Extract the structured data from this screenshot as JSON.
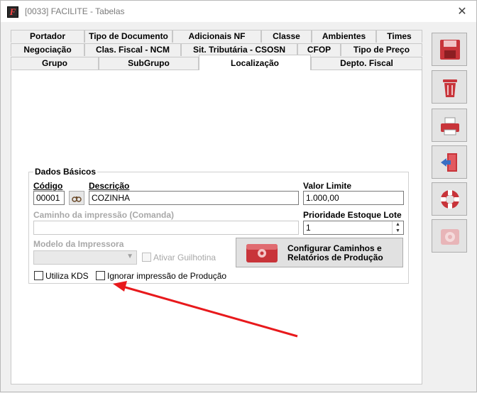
{
  "window": {
    "title": "[0033] FACILITE - Tabelas",
    "app_icon_glyph": "F",
    "close_glyph": "✕"
  },
  "tabs": {
    "row1": [
      "Portador",
      "Tipo de Documento",
      "Adicionais NF",
      "Classe",
      "Ambientes",
      "Times"
    ],
    "row2": [
      "Negociação",
      "Clas. Fiscal - NCM",
      "Sit. Tributária - CSOSN",
      "CFOP",
      "Tipo de Preço"
    ],
    "row3": [
      "Grupo",
      "SubGrupo",
      "Localização",
      "Depto. Fiscal"
    ],
    "active": "Localização"
  },
  "form": {
    "group_title": "Dados Básicos",
    "codigo_label": "Código",
    "codigo_value": "00001",
    "descricao_label": "Descrição",
    "descricao_value": "COZINHA",
    "valor_limite_label": "Valor Limite",
    "valor_limite_value": "1.000,00",
    "caminho_label": "Caminho da impressão (Comanda)",
    "caminho_value": "",
    "prioridade_label": "Prioridade Estoque Lote",
    "prioridade_value": "1",
    "modelo_label": "Modelo da Impressora",
    "modelo_value": "",
    "guilhotina_label": "Ativar Guilhotina",
    "config_button_label": "Configurar Caminhos e Relatórios de Produção",
    "kds_label": "Utiliza KDS",
    "ignorar_label": "Ignorar impressão de Produção"
  },
  "toolbar": {
    "icons": [
      "save-icon",
      "delete-icon",
      "print-icon",
      "exit-icon",
      "help-icon",
      "settings-icon"
    ]
  },
  "colors": {
    "accent": "#c8343a",
    "annotation_arrow": "#e8191c"
  }
}
